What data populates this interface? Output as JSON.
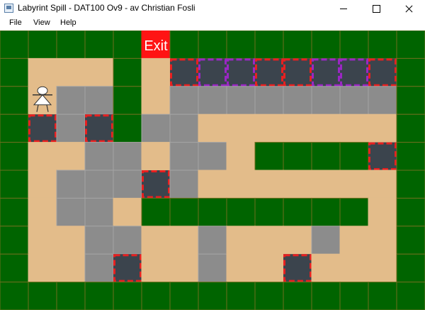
{
  "window": {
    "title": "Labyrint Spill - DAT100 Ov9 - av Christian Fosli",
    "icon": "app-icon"
  },
  "menu": [
    "File",
    "View",
    "Help"
  ],
  "board": {
    "rows": 9,
    "cols": 15,
    "exit_label": "Exit",
    "colors": {
      "wall": "#006400",
      "floor": "#e3bc8a",
      "gray": "#8c8c8c",
      "exit": "#ff1414",
      "dashed_red": "#e82020",
      "dashed_purple": "#9a27c4",
      "block": "#3b444d"
    },
    "grid": [
      "WWWWWXWWWWWWWWW",
      "WFFFWFRPPRRPPRW",
      "WFGGWFGGGGGGGGW",
      "WRGRWGGFFFFFFFW",
      "WFFGGFGGFWWWWRW",
      "WFGGGRGFFFFFFFW",
      "WFGGFWWWWWWWWFW",
      "WFFGGFFGFFFGFFW",
      "WFFGRFFGFFRFFFW",
      "WWWWWWWWWWWWWWW"
    ],
    "player": {
      "row": 2,
      "col": 1,
      "icon": "player-figure-icon"
    }
  }
}
